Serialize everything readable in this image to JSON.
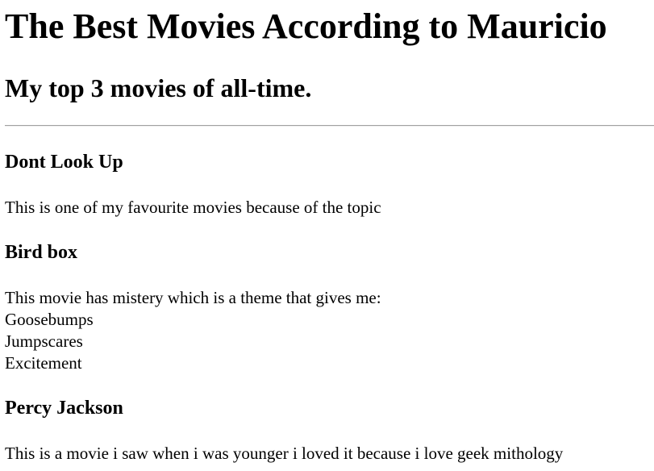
{
  "page": {
    "title": "The Best Movies According to Mauricio",
    "subtitle": "My top 3 movies of all-time."
  },
  "movies": [
    {
      "title": "Dont Look Up",
      "lines": [
        "This is one of my favourite movies because of the topic"
      ]
    },
    {
      "title": "Bird box",
      "lines": [
        "This movie has mistery which is a theme that gives me:",
        "Goosebumps",
        "Jumpscares",
        "Excitement"
      ]
    },
    {
      "title": "Percy Jackson",
      "lines": [
        "This is a movie i saw when i was younger i loved it because i love geek mithology"
      ]
    }
  ]
}
